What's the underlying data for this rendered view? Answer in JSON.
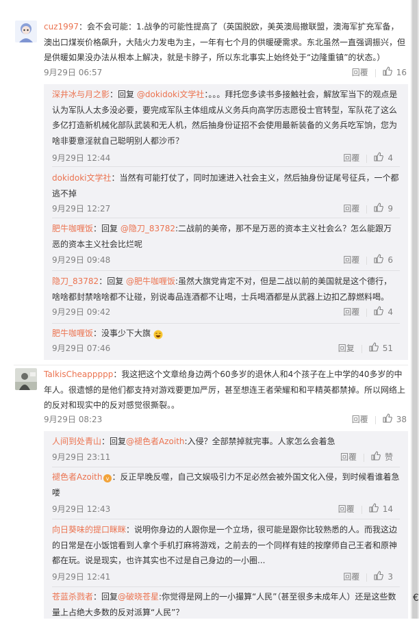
{
  "comments": [
    {
      "user": "cuz1997",
      "text": "：会不会可能：1.战争的可能性提高了（英国脱欧，美英澳局撤联盟，澳海军扩充军备，澳出口煤炭价格飙升，大陆火力发电为主，一年有七个月的供暖硬需求。东北虽然一直强调振兴，但是供暖如果没办法从根本上解决，就是卡脖子，所以东北事实上始终处于“边隆重镇”的状态。）",
      "time": "9月29日 06:57",
      "reply_label": "回覆",
      "likes": "16"
    },
    {
      "user": "TalkisCheappppp",
      "text": "：我这把这个文章给身边两个60多岁的退休人和4个孩子在上中学的40多岁的中年人。很遗憾的是他们都支持对游戏要更加严厉，甚至想连王者荣耀和和平精英都禁掉。所以网络上的反对和现实中的反对感觉很撕裂。。",
      "time": "9月29日 08:23",
      "reply_label": "回覆",
      "likes": "38"
    }
  ],
  "replies_group1": [
    {
      "user": "深井冰与月之影",
      "text_pre": "：回复",
      "mention": "@dokidoki文学社",
      "text": "：。。。拜托您多读书多接触社会，解放军当下的观点是认为军队人太多没必要，要完成军队主体组成从义务兵向高学历志愿役士官转型，军队花了这么多亿打造新机械化部队武装和无人机，然后抽身份证招不会使用最新装备的义务兵吃军饷，您为啥非要意淫就自己聪明别人都沙币？",
      "time": "9月29日 12:44",
      "reply_label": "回覆",
      "likes": "4"
    },
    {
      "user": "dokidoki文学社",
      "text_pre": "",
      "mention": "",
      "text": "：当然有可能打仗了，同时加速进入社会主义，然后抽身份证尾号征兵，一个都逃不掉",
      "time": "9月29日 12:27",
      "reply_label": "回覆",
      "likes": "9"
    },
    {
      "user": "肥牛咖喱饭",
      "text_pre": "：回复",
      "mention": "@隐刀_83782",
      "text": ":二战前的美帝，那不是万恶的资本主义社会么？怎么能跟万恶的资本主义社会比烂呢",
      "time": "9月29日 09:48",
      "reply_label": "回覆",
      "likes": "6"
    },
    {
      "user": "隐刀_83782",
      "text_pre": "：回复",
      "mention": "@肥牛咖喱饭",
      "text": ":虽然大旗党肯定不对，但是二战以前的美国就是这个德行，啥啥都封禁啥啥都不让碰，别说毒品连酒都不让喝，士兵喝酒都是从武器上边扣乙醇燃料喝。",
      "time": "9月29日 09:42",
      "reply_label": "回覆",
      "likes": "4"
    },
    {
      "user": "肥牛咖喱饭",
      "text_pre": "",
      "mention": "",
      "text": "：没事少下大旗",
      "time": "9月29日 07:46",
      "reply_label": "回复",
      "likes": "51"
    }
  ],
  "replies_group2": [
    {
      "user": "人间到处青山",
      "text_pre": "：回复",
      "mention": "@褪色者Azoith",
      "text": ":入侵？全部禁掉就完事。人家怎么会着急",
      "time": "9月29日 23:11",
      "reply_label": "回覆",
      "likes": "赞"
    },
    {
      "user": "褪色者Azoith",
      "text_pre": "",
      "mention": "",
      "text": "：反正早晚反噬，自己文娱吸引力不足必然会被外国文化入侵，到时候看谁着急喽",
      "time": "9月29日 12:43",
      "reply_label": "回覆",
      "likes": "14"
    },
    {
      "user": "向日葵味的提口眯眯",
      "text_pre": "",
      "mention": "",
      "text": "：说明你身边的人跟你是一个立场，很可能是跟你比较熟悉的人。而我这边的日常是在小饭馆看到人拿个手机打麻将游戏，之前去的一个同样有娃的按摩师自己王者和原神都在玩。说是现实，也许其实也不过是自己身边的一小圈...",
      "time": "9月29日 12:41",
      "reply_label": "回覆",
      "likes": "3"
    },
    {
      "user": "苍蓝杀戮者",
      "text_pre": "：回复",
      "mention": "@破晓苍星",
      "text": ":你觉得是网上的一小撮算“人民”（甚至很多未成年人）还是这些数量上占绝大多数的反对派算“人民”？",
      "time": "",
      "reply_label": "",
      "likes": ""
    }
  ],
  "edge_glyph": "€",
  "colors": {
    "link": "#eb7350",
    "muted": "#808080",
    "reply_bg": "#f2f2f5"
  }
}
